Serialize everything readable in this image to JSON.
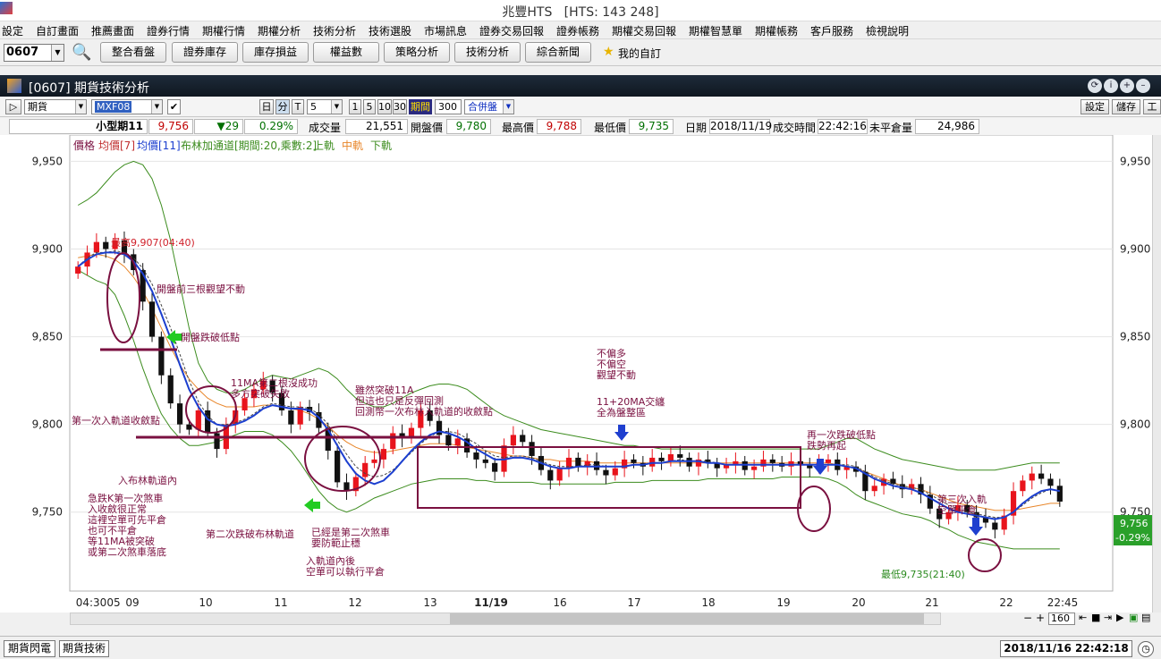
{
  "window": {
    "title": "兆豐HTS   [HTS: 143 248]"
  },
  "menu": [
    "設定",
    "自訂畫面",
    "推薦畫面",
    "證券行情",
    "期權行情",
    "期權分析",
    "技術分析",
    "技術選股",
    "市場訊息",
    "證券交易回報",
    "證券帳務",
    "期權交易回報",
    "期權智慧單",
    "期權帳務",
    "客戶服務",
    "檢視說明"
  ],
  "toolbar": {
    "code": "0607",
    "buttons": [
      "整合看盤",
      "證券庫存",
      "庫存損益",
      "權益數",
      "策略分析",
      "技術分析",
      "綜合新聞"
    ],
    "favorite": "我的自訂"
  },
  "panel": {
    "title": "[0607] 期貨技術分析"
  },
  "controls": {
    "type": "期貨",
    "symbol": "MXF08",
    "period_a": "日",
    "period_b": "分",
    "period_c": "T",
    "interval": "5",
    "q1": "1",
    "q5": "5",
    "q10": "10",
    "q30": "30",
    "range_label": "期間",
    "range_value": "300",
    "merge": "合併盤",
    "settings": "設定",
    "save": "儲存",
    "tool": "工"
  },
  "quote": {
    "name": "小型期11",
    "price": "9,756",
    "change": "▼29",
    "pct": "0.29%",
    "vol_label": "成交量",
    "vol": "21,551",
    "open_label": "開盤價",
    "open": "9,780",
    "high_label": "最高價",
    "high": "9,788",
    "low_label": "最低價",
    "low": "9,735",
    "date_label": "日期",
    "date": "2018/11/19",
    "time_label": "成交時間",
    "time": "22:42:16",
    "oi_label": "未平倉量",
    "oi": "24,986"
  },
  "legend": {
    "price": "價格",
    "ma7": "均價[7]",
    "ma11": "均價[11]",
    "bb": "布林加通道[期間:20,乘數:2]",
    "upper": "上軌",
    "mid": "中軌",
    "lower": "下軌"
  },
  "colors": {
    "up": "#e8141c",
    "down": "#111111",
    "ma7": "#e8862a",
    "ma11": "#1c3fcf",
    "bb": "#3c8c1e",
    "annot": "#7a1040",
    "arrow_green": "#22cc22",
    "arrow_blue": "#1f3fcf"
  },
  "chart_data": {
    "type": "candlestick",
    "ylim": [
      9705,
      9965
    ],
    "yticks": [
      9750,
      9800,
      9850,
      9900,
      9950
    ],
    "ytick_labels": [
      "9,750",
      "9,800",
      "9,850",
      "9,900",
      "9,950"
    ],
    "xtick_labels": [
      "04:30",
      "05",
      "09",
      "10",
      "11",
      "12",
      "13",
      "11/19",
      "16",
      "17",
      "18",
      "19",
      "20",
      "21",
      "22",
      "22:45"
    ],
    "last_label": "9,756",
    "last_pct": "-0.29%",
    "max_label": "最高9,907(04:40)",
    "min_label": "最低9,735(21:40)",
    "closes": [
      9890,
      9898,
      9904,
      9900,
      9905,
      9897,
      9888,
      9870,
      9850,
      9828,
      9812,
      9800,
      9797,
      9808,
      9795,
      9786,
      9800,
      9808,
      9815,
      9820,
      9825,
      9818,
      9808,
      9800,
      9810,
      9807,
      9798,
      9785,
      9767,
      9762,
      9770,
      9778,
      9780,
      9786,
      9795,
      9792,
      9798,
      9808,
      9802,
      9794,
      9788,
      9792,
      9784,
      9780,
      9778,
      9773,
      9788,
      9794,
      9790,
      9782,
      9774,
      9768,
      9775,
      9781,
      9776,
      9779,
      9774,
      9771,
      9775,
      9780,
      9778,
      9776,
      9781,
      9779,
      9783,
      9781,
      9776,
      9780,
      9778,
      9775,
      9777,
      9779,
      9774,
      9776,
      9780,
      9778,
      9776,
      9779,
      9777,
      9775,
      9778,
      9780,
      9774,
      9776,
      9773,
      9762,
      9765,
      9769,
      9766,
      9763,
      9766,
      9760,
      9752,
      9746,
      9750,
      9754,
      9750,
      9747,
      9744,
      9740,
      9748,
      9762,
      9768,
      9772,
      9769,
      9765,
      9756
    ],
    "ma7": [
      9890,
      9895,
      9898,
      9898,
      9899,
      9898,
      9895,
      9889,
      9880,
      9868,
      9855,
      9840,
      9825,
      9813,
      9805,
      9800,
      9800,
      9801,
      9803,
      9806,
      9810,
      9812,
      9811,
      9810,
      9810,
      9809,
      9806,
      9800,
      9791,
      9783,
      9776,
      9772,
      9770,
      9771,
      9774,
      9779,
      9784,
      9789,
      9793,
      9796,
      9796,
      9795,
      9792,
      9789,
      9785,
      9782,
      9781,
      9782,
      9782,
      9781,
      9779,
      9777,
      9776,
      9776,
      9776,
      9777,
      9777,
      9776,
      9776,
      9776,
      9777,
      9777,
      9778,
      9778,
      9779,
      9780,
      9779,
      9779,
      9779,
      9778,
      9777,
      9777,
      9777,
      9777,
      9777,
      9777,
      9777,
      9777,
      9777,
      9777,
      9777,
      9777,
      9777,
      9777,
      9776,
      9773,
      9770,
      9768,
      9766,
      9765,
      9764,
      9763,
      9760,
      9757,
      9754,
      9752,
      9750,
      9749,
      9748,
      9747,
      9747,
      9750,
      9754,
      9758,
      9761,
      9763,
      9762
    ],
    "ma11": [
      9890,
      9894,
      9897,
      9898,
      9898,
      9897,
      9893,
      9886,
      9876,
      9863,
      9849,
      9834,
      9820,
      9810,
      9803,
      9800,
      9799,
      9800,
      9802,
      9805,
      9809,
      9811,
      9810,
      9809,
      9809,
      9808,
      9804,
      9797,
      9788,
      9779,
      9772,
      9768,
      9766,
      9768,
      9773,
      9779,
      9785,
      9790,
      9794,
      9796,
      9795,
      9793,
      9790,
      9786,
      9783,
      9780,
      9780,
      9781,
      9781,
      9780,
      9778,
      9776,
      9775,
      9775,
      9776,
      9776,
      9776,
      9776,
      9776,
      9776,
      9777,
      9777,
      9778,
      9778,
      9779,
      9779,
      9779,
      9779,
      9778,
      9778,
      9777,
      9777,
      9777,
      9777,
      9777,
      9777,
      9777,
      9777,
      9777,
      9777,
      9777,
      9777,
      9777,
      9776,
      9775,
      9772,
      9769,
      9767,
      9765,
      9764,
      9763,
      9761,
      9758,
      9755,
      9752,
      9750,
      9749,
      9748,
      9747,
      9746,
      9747,
      9750,
      9755,
      9759,
      9762,
      9763,
      9762
    ],
    "bb_mid": [
      9895,
      9896,
      9897,
      9896,
      9894,
      9890,
      9884,
      9876,
      9866,
      9855,
      9844,
      9834,
      9826,
      9820,
      9815,
      9812,
      9810,
      9810,
      9810,
      9810,
      9811,
      9811,
      9810,
      9809,
      9808,
      9806,
      9803,
      9799,
      9794,
      9790,
      9787,
      9785,
      9784,
      9784,
      9785,
      9786,
      9787,
      9788,
      9789,
      9789,
      9789,
      9788,
      9787,
      9786,
      9785,
      9784,
      9783,
      9782,
      9782,
      9781,
      9780,
      9780,
      9779,
      9779,
      9779,
      9779,
      9778,
      9778,
      9778,
      9778,
      9778,
      9778,
      9778,
      9778,
      9778,
      9778,
      9778,
      9778,
      9778,
      9778,
      9778,
      9778,
      9778,
      9778,
      9778,
      9778,
      9778,
      9778,
      9778,
      9778,
      9778,
      9778,
      9777,
      9776,
      9775,
      9773,
      9771,
      9769,
      9767,
      9765,
      9764,
      9763,
      9761,
      9759,
      9757,
      9755,
      9754,
      9753,
      9752,
      9751,
      9751,
      9751,
      9752,
      9753,
      9754,
      9755,
      9755
    ],
    "bb_upper": [
      9925,
      9928,
      9932,
      9938,
      9944,
      9948,
      9950,
      9948,
      9940,
      9925,
      9905,
      9880,
      9855,
      9835,
      9825,
      9820,
      9818,
      9818,
      9820,
      9823,
      9826,
      9828,
      9827,
      9826,
      9828,
      9830,
      9832,
      9830,
      9826,
      9820,
      9815,
      9812,
      9810,
      9810,
      9812,
      9815,
      9818,
      9820,
      9822,
      9823,
      9823,
      9822,
      9820,
      9816,
      9812,
      9808,
      9805,
      9803,
      9801,
      9799,
      9797,
      9796,
      9795,
      9794,
      9793,
      9792,
      9791,
      9790,
      9789,
      9788,
      9788,
      9787,
      9787,
      9786,
      9786,
      9786,
      9786,
      9786,
      9786,
      9786,
      9786,
      9786,
      9786,
      9786,
      9786,
      9786,
      9786,
      9786,
      9786,
      9786,
      9786,
      9788,
      9790,
      9792,
      9792,
      9789,
      9786,
      9784,
      9782,
      9780,
      9779,
      9778,
      9777,
      9776,
      9775,
      9774,
      9774,
      9774,
      9774,
      9774,
      9775,
      9776,
      9777,
      9778,
      9778,
      9778,
      9778
    ],
    "bb_lower": [
      9888,
      9885,
      9882,
      9880,
      9874,
      9862,
      9848,
      9832,
      9818,
      9806,
      9798,
      9792,
      9788,
      9788,
      9789,
      9790,
      9792,
      9794,
      9796,
      9796,
      9796,
      9794,
      9790,
      9785,
      9778,
      9770,
      9762,
      9756,
      9752,
      9750,
      9752,
      9755,
      9758,
      9760,
      9762,
      9764,
      9766,
      9767,
      9768,
      9769,
      9769,
      9769,
      9769,
      9768,
      9768,
      9767,
      9767,
      9767,
      9767,
      9767,
      9766,
      9766,
      9766,
      9766,
      9766,
      9766,
      9766,
      9766,
      9767,
      9767,
      9767,
      9767,
      9768,
      9768,
      9768,
      9768,
      9768,
      9768,
      9769,
      9769,
      9769,
      9769,
      9769,
      9769,
      9769,
      9769,
      9770,
      9770,
      9770,
      9770,
      9770,
      9769,
      9767,
      9764,
      9760,
      9757,
      9755,
      9753,
      9751,
      9749,
      9748,
      9747,
      9745,
      9742,
      9740,
      9737,
      9735,
      9733,
      9732,
      9731,
      9730,
      9729,
      9729,
      9729,
      9729,
      9729,
      9729
    ]
  },
  "annotations": {
    "a1": "開盤前三根觀望不動",
    "a2": "開盤跌破低點",
    "a3": "第一次入軌道收斂點",
    "a4": "入布林軌道內",
    "a5": "急跌K第一次煞車",
    "a6": "入收斂很正常",
    "a7": "這裡空單可先平倉",
    "a8": "也可不平倉",
    "a9": "等11MA被突破",
    "a10": "或第二次煞車落底",
    "a11": "11MA第二根沒成功",
    "a12": "多方突破失敗",
    "a13": "第二次跌破布林軌道",
    "a14": "雖然突破11A",
    "a15": "但這也只是反彈回測",
    "a16": "回測幣一次布林入軌道的收斂點",
    "a17": "已經是第二次煞車",
    "a18": "要防範止穩",
    "a19": "入軌道內後",
    "a20": "空單可以執行平倉",
    "a21": "不偏多",
    "a22": "不偏空",
    "a23": "觀望不動",
    "a24": "11+20MA交纏",
    "a25": "全為盤整區",
    "a26": "再一次跌破低點",
    "a27": "跌勢再起",
    "a28": "第三次入軌",
    "a29": "空單平倉"
  },
  "scroll": {
    "zoom": "160"
  },
  "status": {
    "tab1": "期貨閃電",
    "tab2": "期貨技術",
    "datetime": "2018/11/16 22:42:18"
  }
}
